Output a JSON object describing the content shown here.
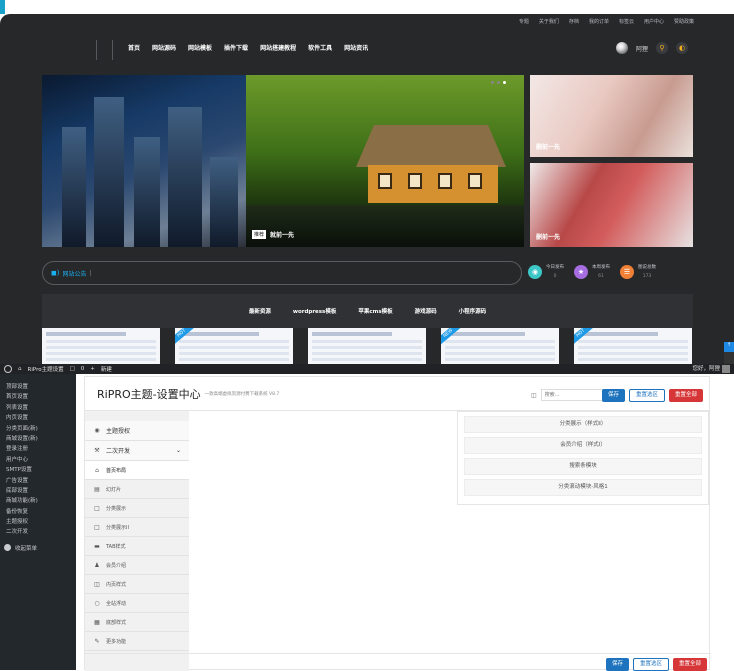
{
  "top_nav": [
    "专题",
    "关于我们",
    "存档",
    "我的订单",
    "标签云",
    "用户中心",
    "赞助政策"
  ],
  "main_nav": [
    "首页",
    "网站源码",
    "网站模板",
    "插件下载",
    "网站搭建教程",
    "软件工具",
    "网站资讯"
  ],
  "user": {
    "name": "阿狸"
  },
  "slider": {
    "tag": "推荐",
    "title": "就前一先"
  },
  "side_banners": [
    "删前一先",
    "删前一先"
  ],
  "notice": {
    "label": "网站公告",
    "separator": "|"
  },
  "stats": [
    {
      "label": "今日发布",
      "value": "0",
      "color": "#3cc6c6",
      "icon": "chart-icon"
    },
    {
      "label": "本周发布",
      "value": "61",
      "color": "#a56de0",
      "icon": "star-icon"
    },
    {
      "label": "图说总数",
      "value": "173",
      "color": "#f08035",
      "icon": "layers-icon"
    }
  ],
  "categories": [
    "最新资源",
    "wordpress模板",
    "苹果cms模板",
    "游戏源码",
    "小程序源码"
  ],
  "thumbs": [
    {
      "ribbon": ""
    },
    {
      "ribbon": "HOT"
    },
    {
      "ribbon": ""
    },
    {
      "ribbon": "NEW"
    },
    {
      "ribbon": "HOT"
    }
  ],
  "admin_bar": {
    "site": "RiPro主题设置",
    "comments": "0",
    "new_label": "新建",
    "greeting": "您好，阿狸"
  },
  "admin_menu": [
    "顶部设置",
    "首页设置",
    "列表设置",
    "内页设置",
    "分类页面(新)",
    "商城设置(新)",
    "登录注册",
    "用户中心",
    "SMTP设置",
    "广告设置",
    "底部设置",
    "商城功能(新)",
    "备份恢复",
    "主题授权",
    "二次开发"
  ],
  "admin_collapse": "收起菜单",
  "panel": {
    "title": "RiPRO主题-设置中心",
    "version": "一款高端虚拟资源付费下载系统 V8.7",
    "search_placeholder": "搜索...",
    "save": "保存",
    "reset": "重置选区",
    "reset_all": "重置全部"
  },
  "panel_menu": [
    {
      "label": "主题授权",
      "icon": "eye-icon",
      "type": "top"
    },
    {
      "label": "二次开发",
      "icon": "wrench-icon",
      "type": "top",
      "chevron": "⌄"
    },
    {
      "label": "首页布局",
      "icon": "home-icon",
      "type": "active"
    },
    {
      "label": "幻灯片",
      "icon": "slides-icon",
      "type": "sub"
    },
    {
      "label": "分类展示",
      "icon": "bookmark-icon",
      "type": "sub"
    },
    {
      "label": "分类展示II",
      "icon": "bookmark-icon",
      "type": "sub"
    },
    {
      "label": "TAB样式",
      "icon": "folder-icon",
      "type": "sub"
    },
    {
      "label": "会员介绍",
      "icon": "user-icon",
      "type": "sub"
    },
    {
      "label": "内页样式",
      "icon": "document-icon",
      "type": "sub"
    },
    {
      "label": "全站浮动",
      "icon": "circle-icon",
      "type": "sub"
    },
    {
      "label": "底部样式",
      "icon": "grid-icon",
      "type": "sub"
    },
    {
      "label": "更多功能",
      "icon": "pencil-icon",
      "type": "sub"
    }
  ],
  "panel_blocks": [
    "分类展示（样式Ⅱ）",
    "会员介绍（样式Ⅰ）",
    "搜索条模块",
    "分类滚动模块-风格1"
  ]
}
